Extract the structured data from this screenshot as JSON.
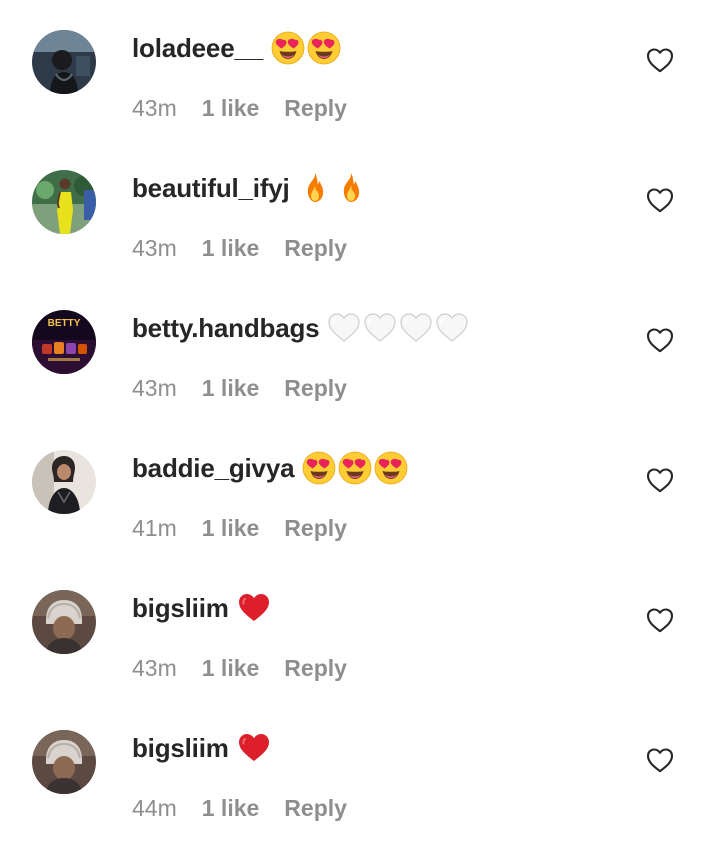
{
  "comments": [
    {
      "username": "loladeee__",
      "emojis": [
        "heart-eyes",
        "heart-eyes"
      ],
      "time": "43m",
      "likes": "1 like",
      "reply": "Reply",
      "avatar": "avatar-1"
    },
    {
      "username": "beautiful_ifyj",
      "emojis": [
        "fire",
        "fire"
      ],
      "time": "43m",
      "likes": "1 like",
      "reply": "Reply",
      "avatar": "avatar-2"
    },
    {
      "username": "betty.handbags",
      "emojis": [
        "white-heart",
        "white-heart",
        "white-heart",
        "white-heart"
      ],
      "time": "43m",
      "likes": "1 like",
      "reply": "Reply",
      "avatar": "avatar-3",
      "avatar_text": "BETTY"
    },
    {
      "username": "baddie_givya",
      "emojis": [
        "heart-eyes",
        "heart-eyes",
        "heart-eyes"
      ],
      "time": "41m",
      "likes": "1 like",
      "reply": "Reply",
      "avatar": "avatar-4"
    },
    {
      "username": "bigsliim",
      "emojis": [
        "red-heart"
      ],
      "time": "43m",
      "likes": "1 like",
      "reply": "Reply",
      "avatar": "avatar-5"
    },
    {
      "username": "bigsliim",
      "emojis": [
        "red-heart"
      ],
      "time": "44m",
      "likes": "1 like",
      "reply": "Reply",
      "avatar": "avatar-5"
    }
  ],
  "colors": {
    "username": "#262626",
    "meta": "#8e8e8e",
    "heart_outline": "#262626"
  }
}
